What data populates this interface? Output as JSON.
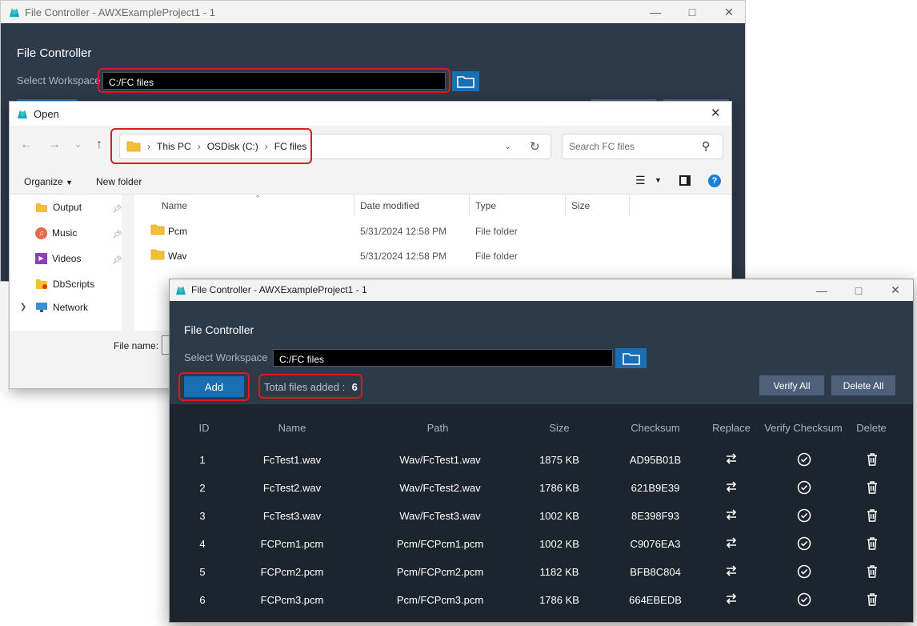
{
  "back_window": {
    "title": "File Controller - AWXExampleProject1 - 1",
    "header": "File Controller",
    "workspace_label": "Select Workspace",
    "workspace_value": "C:/FC files"
  },
  "open_dialog": {
    "title": "Open",
    "breadcrumb": [
      "This PC",
      "OSDisk (C:)",
      "FC files"
    ],
    "search_placeholder": "Search FC files",
    "organize_label": "Organize",
    "new_folder_label": "New folder",
    "nav_items": [
      "Output",
      "Music",
      "Videos",
      "DbScripts",
      "Network"
    ],
    "columns": {
      "name": "Name",
      "date": "Date modified",
      "type": "Type",
      "size": "Size"
    },
    "files": [
      {
        "name": "Pcm",
        "date": "5/31/2024 12:58 PM",
        "type": "File folder"
      },
      {
        "name": "Wav",
        "date": "5/31/2024 12:58 PM",
        "type": "File folder"
      }
    ],
    "filename_label": "File name:"
  },
  "front_window": {
    "title": "File Controller - AWXExampleProject1 - 1",
    "header": "File Controller",
    "workspace_label": "Select Workspace",
    "workspace_value": "C:/FC files",
    "add_label": "Add",
    "total_label": "Total files added :",
    "total_count": "6",
    "verify_all_label": "Verify All",
    "delete_all_label": "Delete All",
    "columns": {
      "id": "ID",
      "name": "Name",
      "path": "Path",
      "size": "Size",
      "checksum": "Checksum",
      "replace": "Replace",
      "verify": "Verify Checksum",
      "delete": "Delete"
    },
    "rows": [
      {
        "id": "1",
        "name": "FcTest1.wav",
        "path": "Wav/FcTest1.wav",
        "size": "1875 KB",
        "checksum": "AD95B01B"
      },
      {
        "id": "2",
        "name": "FcTest2.wav",
        "path": "Wav/FcTest2.wav",
        "size": "1786 KB",
        "checksum": "621B9E39"
      },
      {
        "id": "3",
        "name": "FcTest3.wav",
        "path": "Wav/FcTest3.wav",
        "size": "1002 KB",
        "checksum": "8E398F93"
      },
      {
        "id": "4",
        "name": "FCPcm1.pcm",
        "path": "Pcm/FCPcm1.pcm",
        "size": "1002 KB",
        "checksum": "C9076EA3"
      },
      {
        "id": "5",
        "name": "FCPcm2.pcm",
        "path": "Pcm/FCPcm2.pcm",
        "size": "1182 KB",
        "checksum": "BFB8C804"
      },
      {
        "id": "6",
        "name": "FCPcm3.pcm",
        "path": "Pcm/FCPcm3.pcm",
        "size": "1786 KB",
        "checksum": "664EBEDB"
      }
    ],
    "icons": {
      "replace": "swap-arrows-icon",
      "verify": "check-circle-icon",
      "delete": "trash-icon"
    }
  },
  "colors": {
    "window_bg": "#2d3a4a",
    "grid_bg": "#1c242e",
    "accent_blue": "#1a6fb3",
    "highlight_red": "#e0191f",
    "gray_button": "#4e6178"
  }
}
